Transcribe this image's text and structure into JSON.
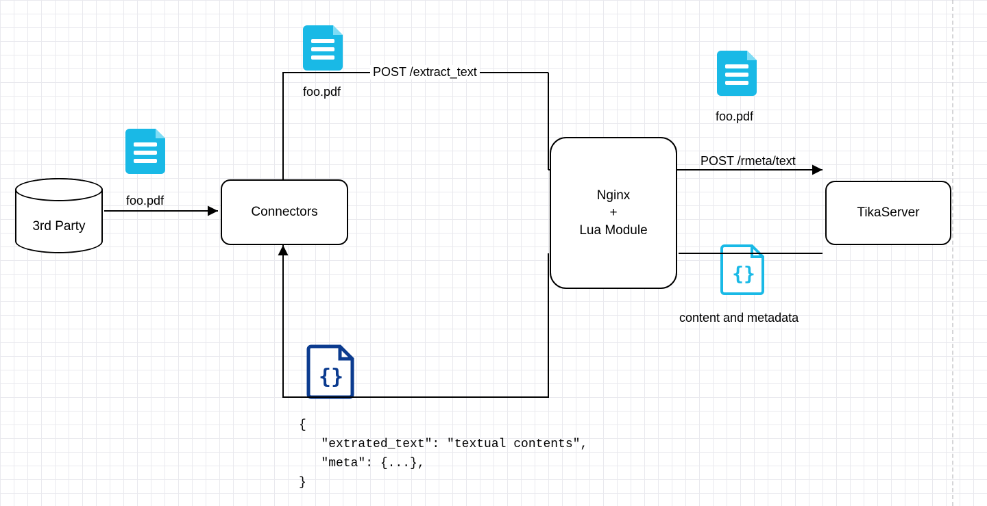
{
  "nodes": {
    "thirdParty": "3rd Party",
    "connectors": "Connectors",
    "nginx": "Nginx\n+\nLua Module",
    "tika": "TikaServer"
  },
  "files": {
    "foo1": "foo.pdf",
    "foo2": "foo.pdf",
    "foo3": "foo.pdf",
    "contentMeta": "content and metadata"
  },
  "edges": {
    "postExtract": "POST /extract_text",
    "postRmeta": "POST /rmeta/text"
  },
  "code": "{\n   \"extrated_text\": \"textual contents\",\n   \"meta\": {...},\n}",
  "colors": {
    "cyan": "#19b9e6",
    "cyanStroke": "#00a9df",
    "navy": "#0b3b8f"
  }
}
